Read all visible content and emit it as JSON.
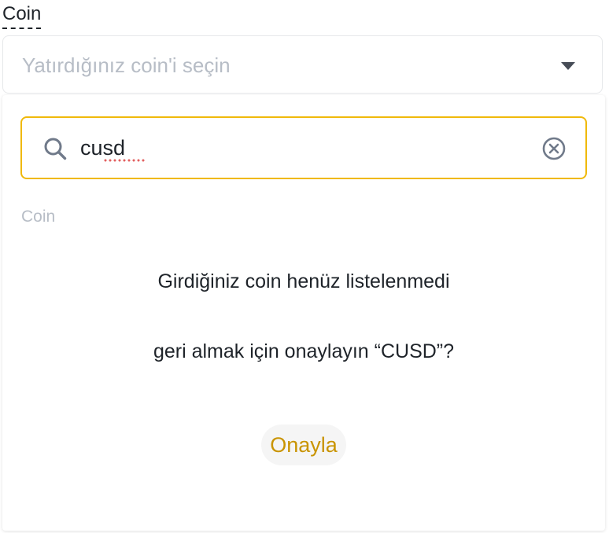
{
  "field": {
    "label": "Coin"
  },
  "select": {
    "placeholder": "Yatırdığınız coin'i seçin"
  },
  "search": {
    "value": "cusd"
  },
  "dropdown": {
    "section_label": "Coin",
    "message_line1": "Girdiğiniz coin henüz listelenmedi",
    "message_line2": "geri almak için onaylayın “CUSD”?",
    "confirm_label": "Onayla"
  },
  "colors": {
    "accent": "#f0b90b",
    "confirm_text": "#c99400",
    "placeholder": "#b7bdc6",
    "text_primary": "#1e2329"
  },
  "icons": {
    "select_caret": "caret-down-icon",
    "search": "search-icon",
    "clear": "clear-circle-x-icon"
  }
}
